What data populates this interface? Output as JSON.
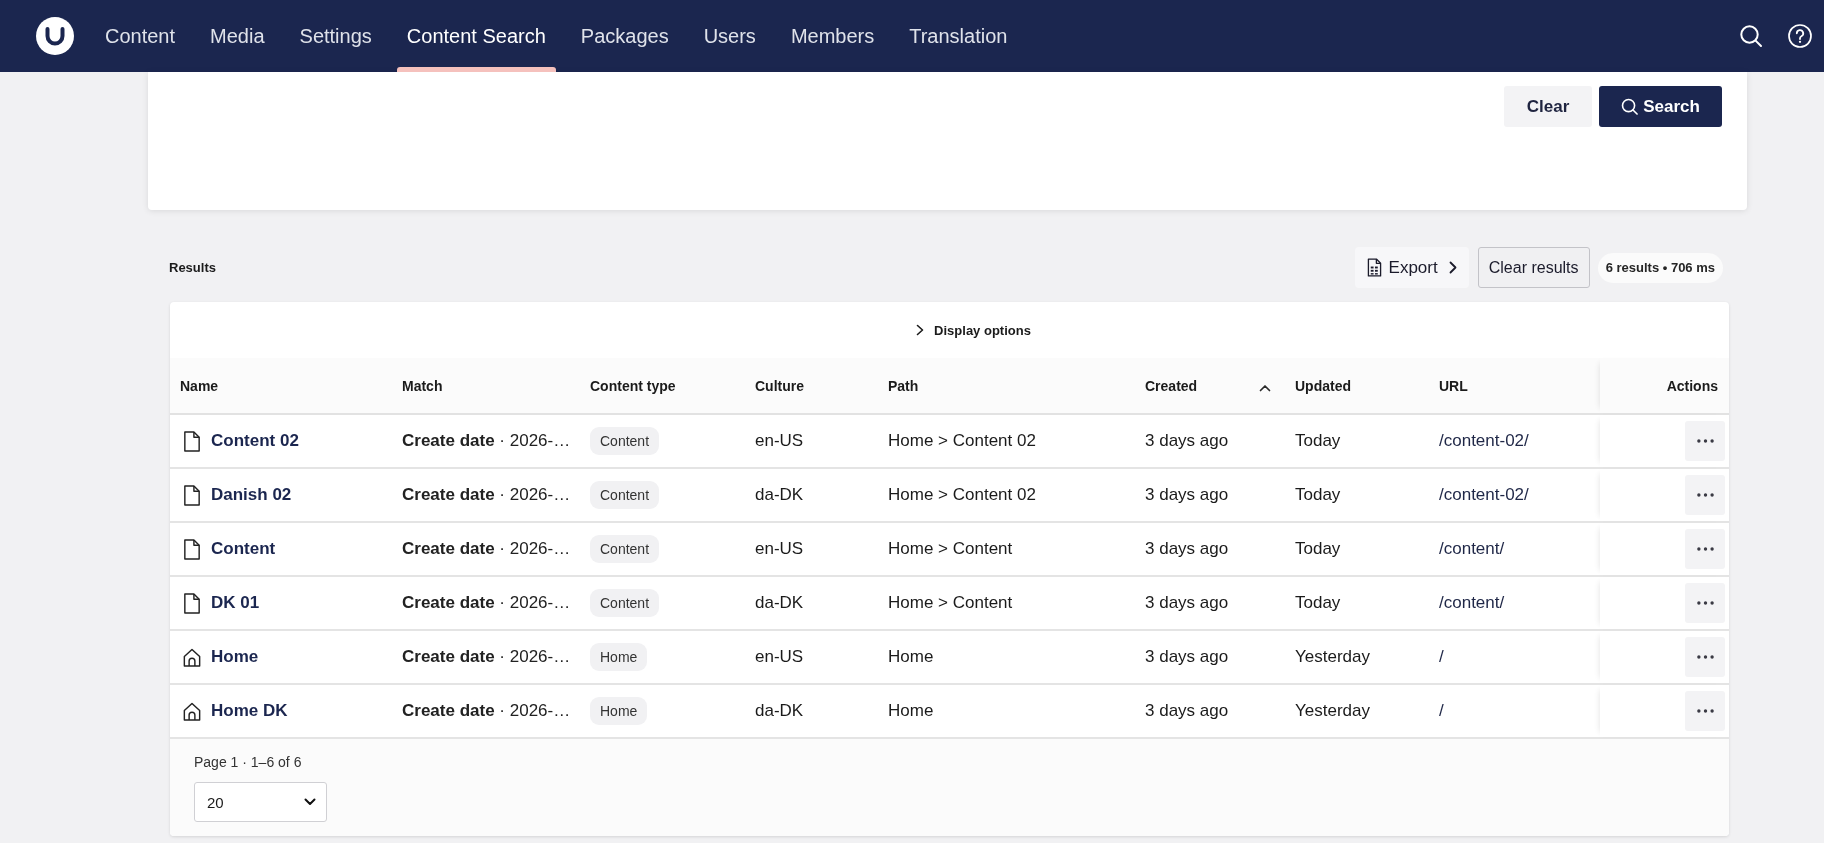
{
  "header": {
    "nav": [
      {
        "label": "Content",
        "selected": false
      },
      {
        "label": "Media",
        "selected": false
      },
      {
        "label": "Settings",
        "selected": false
      },
      {
        "label": "Content Search",
        "selected": true
      },
      {
        "label": "Packages",
        "selected": false
      },
      {
        "label": "Users",
        "selected": false
      },
      {
        "label": "Members",
        "selected": false
      },
      {
        "label": "Translation",
        "selected": false
      }
    ]
  },
  "search_panel": {
    "buttons": [
      {
        "label": "Clear",
        "kind": "secondary"
      },
      {
        "label": "Search",
        "kind": "primary"
      }
    ]
  },
  "results": {
    "title": "Results",
    "export_button": "Export",
    "clear_button": "Clear results",
    "summary": "6 results • 706 ms",
    "display_options": {
      "label": "Display options",
      "expanded": false
    },
    "table": {
      "columns": [
        {
          "label": "Name",
          "kind": "data",
          "sorted": false
        },
        {
          "label": "Match",
          "kind": "data",
          "sorted": false
        },
        {
          "label": "Content type",
          "kind": "data",
          "sorted": false
        },
        {
          "label": "Culture",
          "kind": "data",
          "sorted": false
        },
        {
          "label": "Path",
          "kind": "data",
          "sorted": false
        },
        {
          "label": "Created",
          "kind": "data",
          "sorted": true
        },
        {
          "label": "Updated",
          "kind": "data",
          "sorted": false
        },
        {
          "label": "URL",
          "kind": "data",
          "sorted": false
        },
        {
          "label": "Actions",
          "kind": "actions",
          "sorted": false
        }
      ],
      "rows": [
        {
          "kind": "document",
          "name": "Content 02",
          "match": "**Create date** · 2026-…",
          "content_type": "Content",
          "culture": "en-US",
          "path": "Home > Content 02",
          "created": "3 days ago",
          "updated": "Today",
          "url": "/content-02/"
        },
        {
          "kind": "document",
          "name": "Danish 02",
          "match": "**Create date** · 2026-…",
          "content_type": "Content",
          "culture": "da-DK",
          "path": "Home > Content 02",
          "created": "3 days ago",
          "updated": "Today",
          "url": "/content-02/"
        },
        {
          "kind": "document",
          "name": "Content",
          "match": "**Create date** · 2026-…",
          "content_type": "Content",
          "culture": "en-US",
          "path": "Home > Content",
          "created": "3 days ago",
          "updated": "Today",
          "url": "/content/"
        },
        {
          "kind": "document",
          "name": "DK 01",
          "match": "**Create date** · 2026-…",
          "content_type": "Content",
          "culture": "da-DK",
          "path": "Home > Content",
          "created": "3 days ago",
          "updated": "Today",
          "url": "/content/"
        },
        {
          "kind": "home",
          "name": "Home",
          "match": "**Create date** · 2026-…",
          "content_type": "Home",
          "culture": "en-US",
          "path": "Home",
          "created": "3 days ago",
          "updated": "Yesterday",
          "url": "/"
        },
        {
          "kind": "home",
          "name": "Home DK",
          "match": "**Create date** · 2026-…",
          "content_type": "Home",
          "culture": "da-DK",
          "path": "Home",
          "created": "3 days ago",
          "updated": "Yesterday",
          "url": "/"
        }
      ]
    },
    "footer": {
      "page_info": "Page 1 · 1–6 of 6",
      "page_size": "20"
    }
  }
}
